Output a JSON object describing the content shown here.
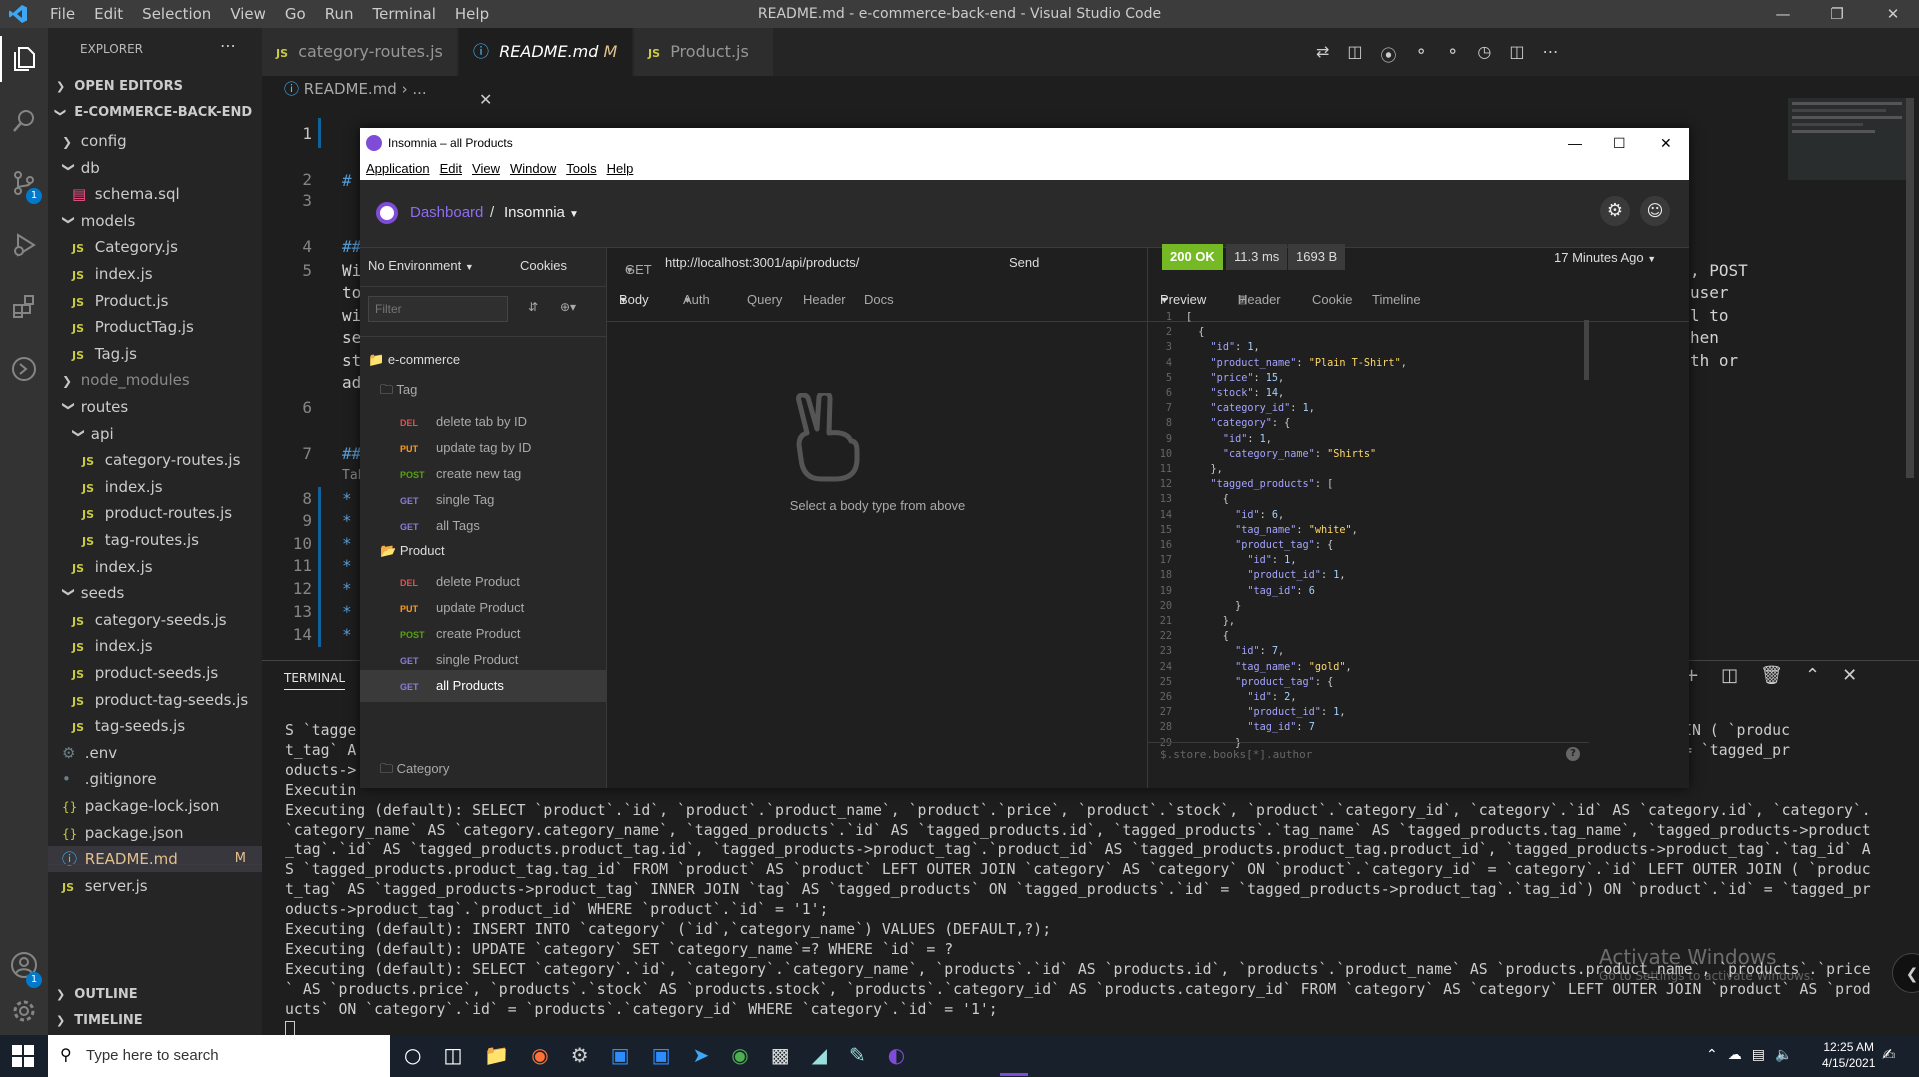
{
  "vscode": {
    "menu": [
      "File",
      "Edit",
      "Selection",
      "View",
      "Go",
      "Run",
      "Terminal",
      "Help"
    ],
    "window_title": "README.md - e-commerce-back-end - Visual Studio Code",
    "explorer_title": "EXPLORER",
    "open_editors": "OPEN EDITORS",
    "project": "E-COMMERCE-BACK-END",
    "tree": [
      {
        "label": "config",
        "kind": "folder-closed",
        "depth": 1
      },
      {
        "label": "db",
        "kind": "folder-open",
        "depth": 1
      },
      {
        "label": "schema.sql",
        "kind": "sql",
        "depth": 2
      },
      {
        "label": "models",
        "kind": "folder-open",
        "depth": 1
      },
      {
        "label": "Category.js",
        "kind": "js",
        "depth": 2
      },
      {
        "label": "index.js",
        "kind": "js",
        "depth": 2
      },
      {
        "label": "Product.js",
        "kind": "js",
        "depth": 2
      },
      {
        "label": "ProductTag.js",
        "kind": "js",
        "depth": 2
      },
      {
        "label": "Tag.js",
        "kind": "js",
        "depth": 2
      },
      {
        "label": "node_modules",
        "kind": "folder-closed-dim",
        "depth": 1
      },
      {
        "label": "routes",
        "kind": "folder-open",
        "depth": 1
      },
      {
        "label": "api",
        "kind": "folder-open",
        "depth": 2
      },
      {
        "label": "category-routes.js",
        "kind": "js",
        "depth": 3
      },
      {
        "label": "index.js",
        "kind": "js",
        "depth": 3
      },
      {
        "label": "product-routes.js",
        "kind": "js",
        "depth": 3
      },
      {
        "label": "tag-routes.js",
        "kind": "js",
        "depth": 3
      },
      {
        "label": "index.js",
        "kind": "js",
        "depth": 2
      },
      {
        "label": "seeds",
        "kind": "folder-open",
        "depth": 1
      },
      {
        "label": "category-seeds.js",
        "kind": "js",
        "depth": 2
      },
      {
        "label": "index.js",
        "kind": "js",
        "depth": 2
      },
      {
        "label": "product-seeds.js",
        "kind": "js",
        "depth": 2
      },
      {
        "label": "product-tag-seeds.js",
        "kind": "js",
        "depth": 2
      },
      {
        "label": "tag-seeds.js",
        "kind": "js",
        "depth": 2
      },
      {
        "label": ".env",
        "kind": "gear",
        "depth": 1
      },
      {
        "label": ".gitignore",
        "kind": "plain",
        "depth": 1
      },
      {
        "label": "package-lock.json",
        "kind": "json",
        "depth": 1
      },
      {
        "label": "package.json",
        "kind": "json",
        "depth": 1
      },
      {
        "label": "README.md",
        "kind": "info",
        "depth": 1,
        "badge": "M"
      },
      {
        "label": "server.js",
        "kind": "js",
        "depth": 1
      }
    ],
    "outline": "OUTLINE",
    "timeline": "TIMELINE",
    "tabs": [
      {
        "label": "category-routes.js",
        "icon": "JS"
      },
      {
        "label": "README.md",
        "icon": "i",
        "modified": "M"
      },
      {
        "label": "Product.js",
        "icon": "JS"
      }
    ],
    "breadcrumb": [
      "README.md",
      "..."
    ],
    "line_numbers": [
      "1",
      "2",
      "3",
      "4",
      "5",
      "6",
      "7",
      "8",
      "9",
      "10",
      "11",
      "12",
      "13",
      "14"
    ],
    "code_fragments": {
      "l2": "#",
      "l4": "##",
      "l5": [
        "Wi",
        "to",
        "wi",
        "se",
        "st",
        "ad"
      ],
      "l7": "##",
      "l7b": "Tab",
      "bullets": [
        "*",
        "*",
        "*",
        "*",
        "*",
        "*",
        "*"
      ],
      "right_text": [
        ", POST",
        " user",
        "l to",
        "hen",
        "th or"
      ]
    },
    "activity_badge": "1",
    "terminal_label": "TERMINAL",
    "terminal_lines": [
      "S `tagge",
      "t_tag` A",
      "oducts->",
      "Executin",
      "Executing (default): SELECT `product`.`id`, `product`.`product_name`, `product`.`price`, `product`.`stock`, `product`.`category_id`, `category`.`id` AS `category.id`, `category`.",
      "`category_name` AS `category.category_name`, `tagged_products`.`id` AS `tagged_products.id`, `tagged_products`.`tag_name` AS `tagged_products.tag_name`, `tagged_products->product",
      "_tag`.`id` AS `tagged_products.product_tag.id`, `tagged_products->product_tag`.`product_id` AS `tagged_products.product_tag.product_id`, `tagged_products->product_tag`.`tag_id` A",
      "S `tagged_products.product_tag.tag_id` FROM `product` AS `product` LEFT OUTER JOIN `category` AS `category` ON `product`.`category_id` = `category`.`id` LEFT OUTER JOIN ( `produc",
      "t_tag` AS `tagged_products->product_tag` INNER JOIN `tag` AS `tagged_products` ON `tagged_products`.`id` = `tagged_products->product_tag`.`tag_id`) ON `product`.`id` = `tagged_pr",
      "oducts->product_tag`.`product_id` WHERE `product`.`id` = '1';",
      "Executing (default): INSERT INTO `category` (`id`,`category_name`) VALUES (DEFAULT,?);",
      "Executing (default): UPDATE `category` SET `category_name`=? WHERE `id` = ?",
      "Executing (default): SELECT `category`.`id`, `category`.`category_name`, `products`.`id` AS `products.id`, `products`.`product_name` AS `products.product_name`, `products`.`price",
      "` AS `products.price`, `products`.`stock` AS `products.stock`, `products`.`category_id` AS `products.category_id` FROM `category` AS `category` LEFT OUTER JOIN `product` AS `prod",
      "ucts` ON `category`.`id` = `products`.`category_id` WHERE `category`.`id` = '1';"
    ],
    "terminal_right_fragments": [
      "T OUTER JOIN ( `produc",
      "uct`.`id` = `tagged_pr"
    ],
    "watermark": "Activate Windows",
    "watermark_sub": "Go to Settings to activate Windows."
  },
  "insomnia": {
    "title": "Insomnia – all Products",
    "menu": [
      "Application",
      "Edit",
      "View",
      "Window",
      "Tools",
      "Help"
    ],
    "breadcrumb_link": "Dashboard",
    "breadcrumb_sep": "/",
    "workspace": "Insomnia",
    "environment": "No Environment",
    "cookies": "Cookies",
    "filter_placeholder": "Filter",
    "collection": "e-commerce",
    "folders": [
      "Tag",
      "Product",
      "Category"
    ],
    "tag_requests": [
      {
        "method": "DEL",
        "name": "delete tab by ID"
      },
      {
        "method": "PUT",
        "name": "update tag by ID"
      },
      {
        "method": "POST",
        "name": "create new tag"
      },
      {
        "method": "GET",
        "name": "single Tag"
      },
      {
        "method": "GET",
        "name": "all Tags"
      }
    ],
    "product_requests": [
      {
        "method": "DEL",
        "name": "delete Product"
      },
      {
        "method": "PUT",
        "name": "update Product"
      },
      {
        "method": "POST",
        "name": "create Product"
      },
      {
        "method": "GET",
        "name": "single Product"
      },
      {
        "method": "GET",
        "name": "all Products"
      }
    ],
    "request_method": "GET",
    "url": "http://localhost:3001/api/products/",
    "send": "Send",
    "req_tabs": [
      "Body",
      "Auth",
      "Query",
      "Header",
      "Docs"
    ],
    "body_hint": "Select a body type from above",
    "status": "200 OK",
    "time": "11.3 ms",
    "size": "1693 B",
    "ago": "17 Minutes Ago",
    "resp_tabs": [
      "Preview",
      "Header",
      "Cookie",
      "Timeline"
    ],
    "header_count": "7",
    "filter_hint": "$.store.books[*].author",
    "response_json": [
      [
        "[",
        ""
      ],
      [
        "  {",
        ""
      ],
      [
        "    ",
        "\"id\"",
        ": ",
        "1",
        ","
      ],
      [
        "    ",
        "\"product_name\"",
        ": ",
        "\"Plain T-Shirt\"",
        ","
      ],
      [
        "    ",
        "\"price\"",
        ": ",
        "15",
        ","
      ],
      [
        "    ",
        "\"stock\"",
        ": ",
        "14",
        ","
      ],
      [
        "    ",
        "\"category_id\"",
        ": ",
        "1",
        ","
      ],
      [
        "    ",
        "\"category\"",
        ": ",
        "{",
        ""
      ],
      [
        "      ",
        "\"id\"",
        ": ",
        "1",
        ","
      ],
      [
        "      ",
        "\"category_name\"",
        ": ",
        "\"Shirts\"",
        ""
      ],
      [
        "    },",
        ""
      ],
      [
        "    ",
        "\"tagged_products\"",
        ": ",
        "[",
        ""
      ],
      [
        "      {",
        ""
      ],
      [
        "        ",
        "\"id\"",
        ": ",
        "6",
        ","
      ],
      [
        "        ",
        "\"tag_name\"",
        ": ",
        "\"white\"",
        ","
      ],
      [
        "        ",
        "\"product_tag\"",
        ": ",
        "{",
        ""
      ],
      [
        "          ",
        "\"id\"",
        ": ",
        "1",
        ","
      ],
      [
        "          ",
        "\"product_id\"",
        ": ",
        "1",
        ","
      ],
      [
        "          ",
        "\"tag_id\"",
        ": ",
        "6",
        ""
      ],
      [
        "        }",
        ""
      ],
      [
        "      },",
        ""
      ],
      [
        "      {",
        ""
      ],
      [
        "        ",
        "\"id\"",
        ": ",
        "7",
        ","
      ],
      [
        "        ",
        "\"tag_name\"",
        ": ",
        "\"gold\"",
        ","
      ],
      [
        "        ",
        "\"product_tag\"",
        ": ",
        "{",
        ""
      ],
      [
        "          ",
        "\"id\"",
        ": ",
        "2",
        ","
      ],
      [
        "          ",
        "\"product_id\"",
        ": ",
        "1",
        ","
      ],
      [
        "          ",
        "\"tag_id\"",
        ": ",
        "7",
        ""
      ],
      [
        "        }",
        ""
      ]
    ]
  },
  "taskbar": {
    "search_placeholder": "Type here to search",
    "time": "12:25 AM",
    "date": "4/15/2021"
  }
}
